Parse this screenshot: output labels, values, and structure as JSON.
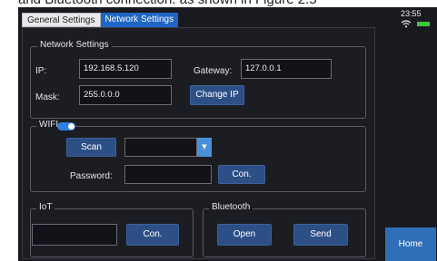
{
  "caption": "and Bluetooth connection. as shown in Figure 2.5",
  "tabs": [
    {
      "label": "General Settings",
      "active": false
    },
    {
      "label": "Network Settings",
      "active": true
    }
  ],
  "network": {
    "legend": "Network Settings",
    "ip_label": "IP:",
    "ip_value": "192.168.5.120",
    "gateway_label": "Gateway:",
    "gateway_value": "127.0.0.1",
    "mask_label": "Mask:",
    "mask_value": "255.0.0.0",
    "change_ip": "Change IP"
  },
  "wifi": {
    "legend": "WIFI",
    "enabled": true,
    "scan": "Scan",
    "ssid_value": "",
    "password_label": "Password:",
    "password_value": "",
    "connect": "Con."
  },
  "iot": {
    "legend": "IoT",
    "value": "",
    "connect": "Con."
  },
  "bluetooth": {
    "legend": "Bluetooth",
    "open": "Open",
    "send": "Send"
  },
  "status": {
    "time": "23:55",
    "battery_color": "#3ec43e"
  },
  "home": "Home",
  "colors": {
    "accent": "#1f66c4",
    "button": "#2c4f86",
    "background": "#191a1f"
  }
}
